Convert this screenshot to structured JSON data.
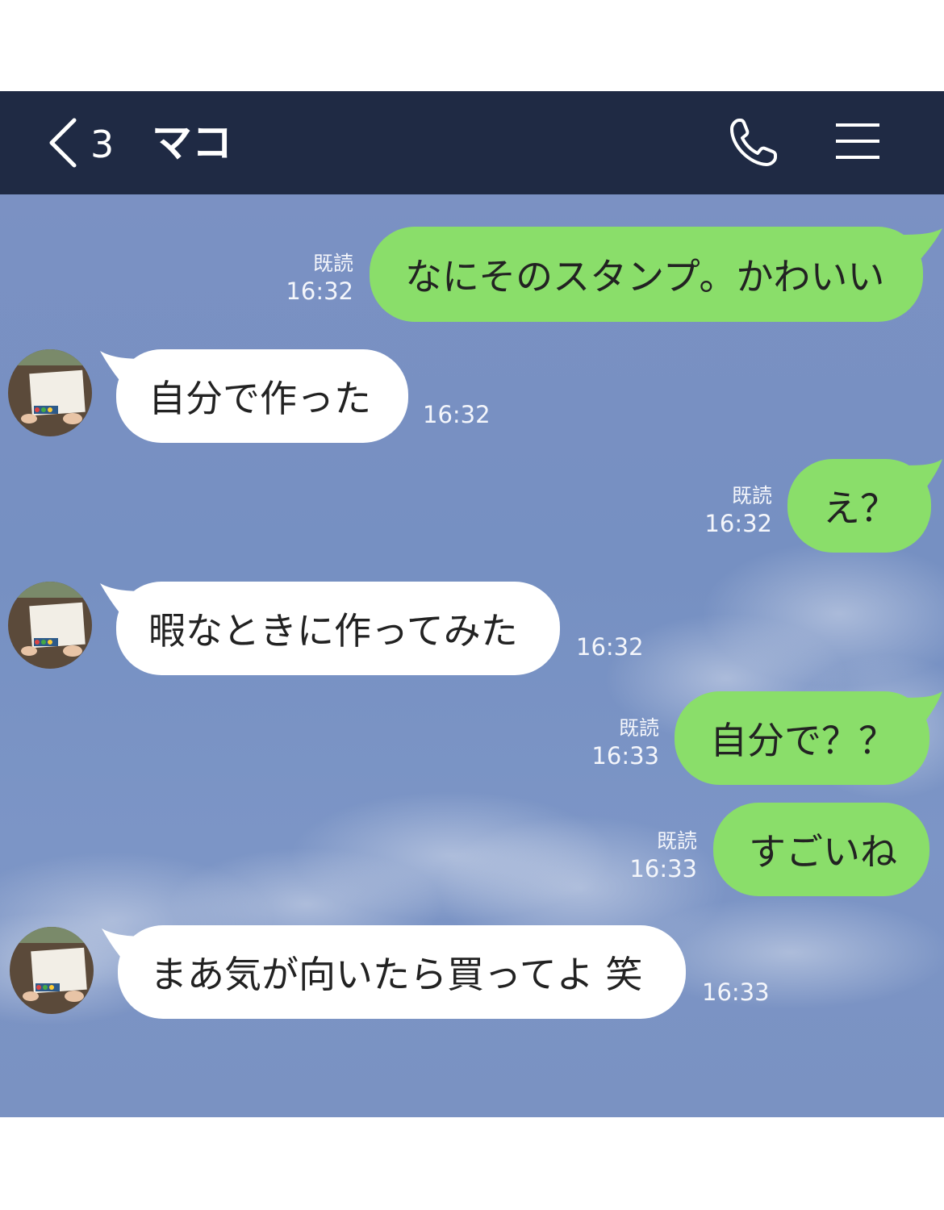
{
  "header": {
    "back_icon": "chevron-left-icon",
    "unread_count": "3",
    "contact_name": "マコ",
    "call_icon": "phone-icon",
    "menu_icon": "hamburger-menu-icon"
  },
  "colors": {
    "header_bg": "#1f2a44",
    "chat_bg": "#7a92c3",
    "sent_bubble": "#8ade6a",
    "received_bubble": "#ffffff"
  },
  "messages": [
    {
      "direction": "sent",
      "text": "なにそのスタンプ。かわいい",
      "read_label": "既読",
      "time": "16:32"
    },
    {
      "direction": "received",
      "text": "自分で作った",
      "time": "16:32"
    },
    {
      "direction": "sent",
      "text": "え？",
      "read_label": "既読",
      "time": "16:32"
    },
    {
      "direction": "received",
      "text": "暇なときに作ってみた",
      "time": "16:32"
    },
    {
      "direction": "sent",
      "text": "自分で？？",
      "read_label": "既読",
      "time": "16:33"
    },
    {
      "direction": "sent",
      "text": "すごいね",
      "read_label": "既読",
      "time": "16:33"
    },
    {
      "direction": "received",
      "text": "まあ気が向いたら買ってよ 笑",
      "time": "16:33"
    }
  ]
}
